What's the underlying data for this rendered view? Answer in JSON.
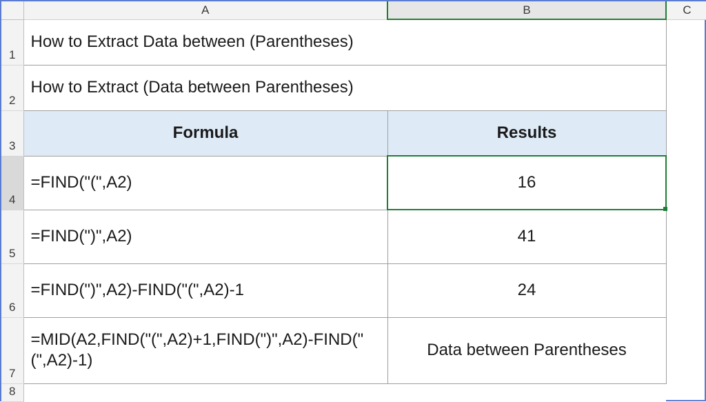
{
  "columns": {
    "A": "A",
    "B": "B",
    "C": "C"
  },
  "rows": {
    "r1": "1",
    "r2": "2",
    "r3": "3",
    "r4": "4",
    "r5": "5",
    "r6": "6",
    "r7": "7",
    "r8": "8"
  },
  "cells": {
    "A1": "How to Extract Data between (Parentheses)",
    "A2": "How to Extract (Data between Parentheses)",
    "A3": "Formula",
    "B3": "Results",
    "A4": "=FIND(\"(\",A2)",
    "B4": "16",
    "A5": "=FIND(\")\",A2)",
    "B5": "41",
    "A6": "=FIND(\")\",A2)-FIND(\"(\",A2)-1",
    "B6": "24",
    "A7": "=MID(A2,FIND(\"(\",A2)+1,FIND(\")\",A2)-FIND(\"(\",A2)-1)",
    "B7": "Data between Parentheses"
  },
  "active_cell": "B4",
  "chart_data": {
    "type": "table",
    "title": "How to Extract Data between (Parentheses)",
    "input_text": "How to Extract (Data between Parentheses)",
    "columns": [
      "Formula",
      "Results"
    ],
    "rows": [
      {
        "Formula": "=FIND(\"(\",A2)",
        "Results": 16
      },
      {
        "Formula": "=FIND(\")\",A2)",
        "Results": 41
      },
      {
        "Formula": "=FIND(\")\",A2)-FIND(\"(\",A2)-1",
        "Results": 24
      },
      {
        "Formula": "=MID(A2,FIND(\"(\",A2)+1,FIND(\")\",A2)-FIND(\"(\",A2)-1)",
        "Results": "Data between Parentheses"
      }
    ]
  }
}
